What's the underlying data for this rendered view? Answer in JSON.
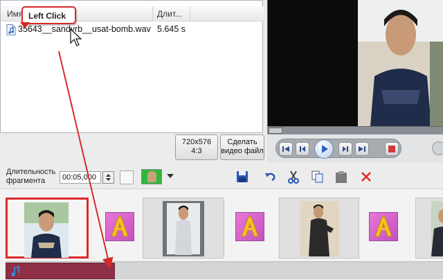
{
  "file_list": {
    "col_name": "Имя",
    "col_duration": "Длит...",
    "rows": [
      {
        "name": "35643__sandyrb__usat-bomb.wav",
        "duration": "5.645 s"
      }
    ]
  },
  "callout": {
    "label": "Left Click"
  },
  "format_buttons": {
    "resolution": "720x576",
    "aspect": "4:3",
    "make_line1": "Сделать",
    "make_line2": "видео файл"
  },
  "toolbar": {
    "duration_label_line1": "Длительность",
    "duration_label_line2": "фрагмента",
    "duration_value": "00:05,000"
  },
  "colors": {
    "accent_red": "#e02828",
    "preview_blue": "#1d5a9e",
    "audio_clip": "#8e2f45",
    "transition_pink": "#d35fcb"
  },
  "icons": [
    "audio-file-icon",
    "play-icon",
    "stop-icon",
    "save-icon",
    "undo-icon",
    "cut-icon",
    "copy-icon",
    "paste-icon",
    "delete-icon",
    "music-note-icon"
  ]
}
